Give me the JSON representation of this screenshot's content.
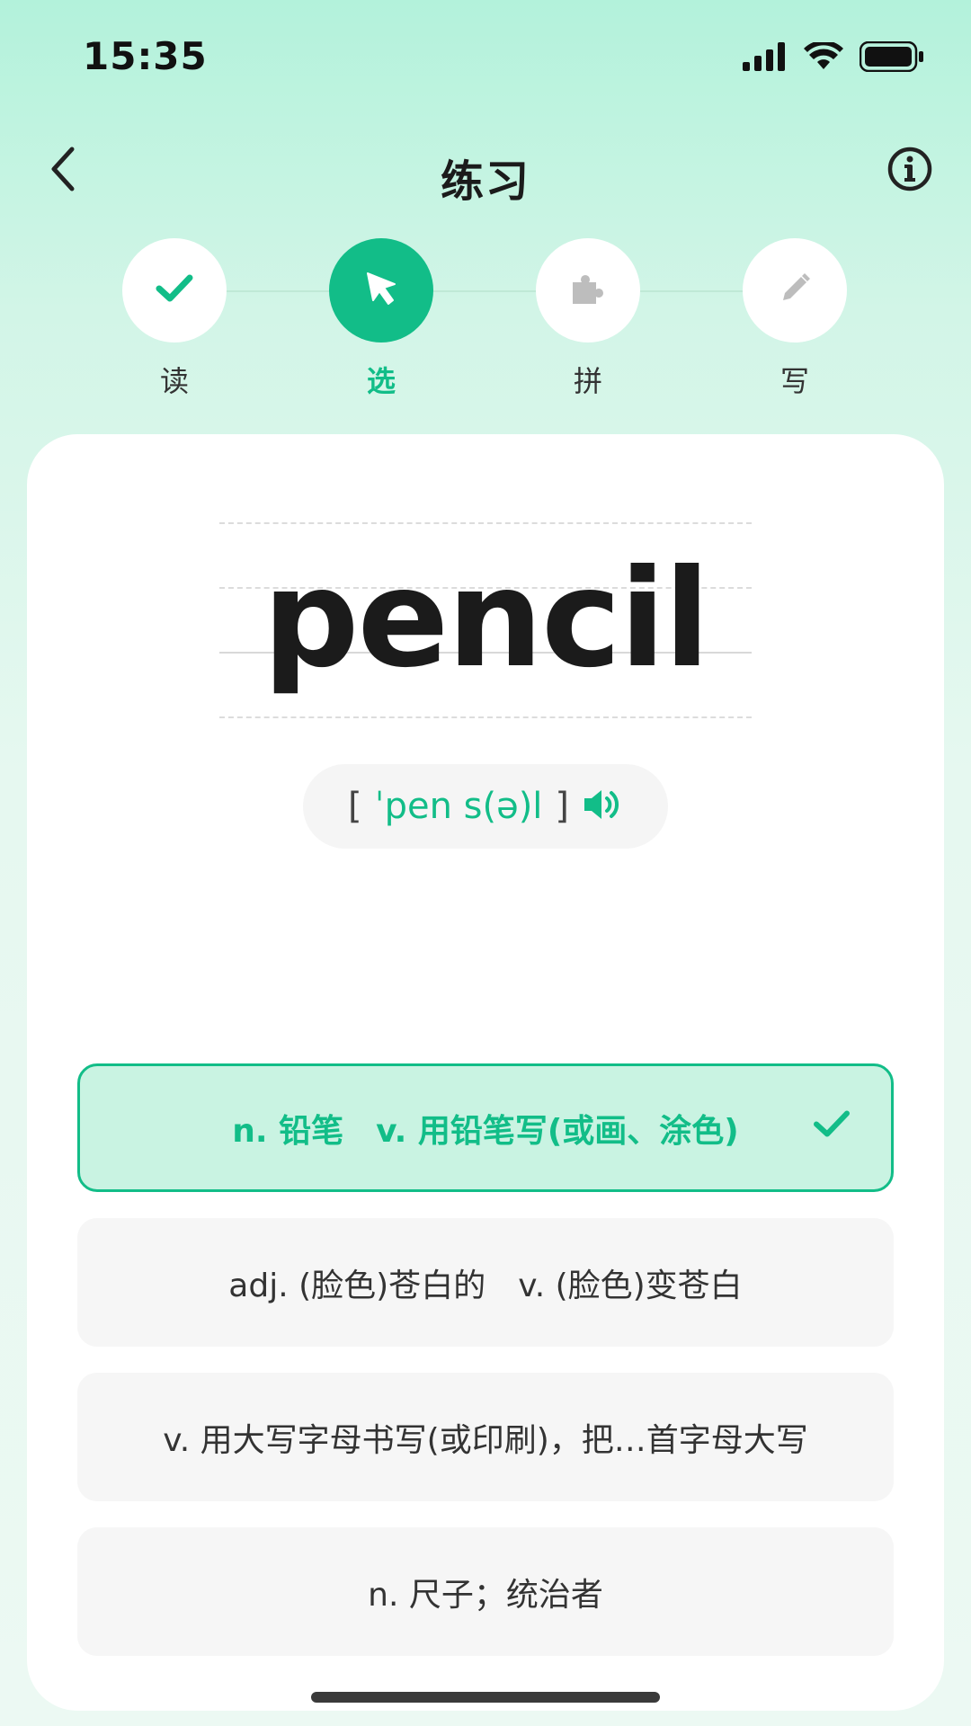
{
  "status_bar": {
    "time": "15:35",
    "icons": [
      "signal-icon",
      "wifi-icon",
      "battery-icon"
    ]
  },
  "nav": {
    "title": "练习",
    "back_icon": "chevron-left-icon",
    "info_icon": "info-icon"
  },
  "steps": [
    {
      "label": "读",
      "icon": "check-icon",
      "state": "done"
    },
    {
      "label": "选",
      "icon": "cursor-icon",
      "state": "active"
    },
    {
      "label": "拼",
      "icon": "puzzle-icon",
      "state": "todo"
    },
    {
      "label": "写",
      "icon": "pencil-icon",
      "state": "todo"
    }
  ],
  "word": {
    "text": "pencil",
    "phonetic_open": "[",
    "phonetic": "ˈpen s(ə)l",
    "phonetic_close": "]",
    "sound_icon": "speaker-icon"
  },
  "options": [
    {
      "text": "n. 铅笔　v. 用铅笔写(或画、涂色)",
      "state": "correct"
    },
    {
      "text": "adj. (脸色)苍白的　v. (脸色)变苍白",
      "state": "normal"
    },
    {
      "text": "v. 用大写字母书写(或印刷)，把…首字母大写",
      "state": "normal"
    },
    {
      "text": "n. 尺子；统治者",
      "state": "normal"
    }
  ],
  "colors": {
    "accent": "#12bd88",
    "accent_light": "#c9f3e2",
    "background_top": "#b3f2db"
  }
}
